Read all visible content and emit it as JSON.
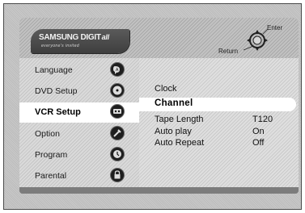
{
  "header": {
    "brand": "SAMSUNG DIGIT",
    "brand_suffix": "all",
    "brand_tagline": "everyone's invited",
    "enter_label": "Enter",
    "return_label": "Return"
  },
  "sidebar": {
    "items": [
      {
        "label": "Language",
        "icon": "language-icon"
      },
      {
        "label": "DVD Setup",
        "icon": "disc-icon"
      },
      {
        "label": "VCR Setup",
        "icon": "cassette-icon",
        "active": true
      },
      {
        "label": "Option",
        "icon": "option-icon"
      },
      {
        "label": "Program",
        "icon": "program-icon"
      },
      {
        "label": "Parental",
        "icon": "lock-icon"
      }
    ]
  },
  "content": {
    "items": [
      {
        "label": "Clock",
        "value": ""
      },
      {
        "label": "Channel",
        "value": "",
        "selected": true
      },
      {
        "label": "Tape Length",
        "value": "T120"
      },
      {
        "label": "Auto play",
        "value": "On"
      },
      {
        "label": "Auto Repeat",
        "value": "Off"
      }
    ]
  },
  "colors": {
    "highlight": "#ffffff",
    "icon_bg": "#1e1e1e",
    "logo_bg": "#4a4a4a"
  }
}
